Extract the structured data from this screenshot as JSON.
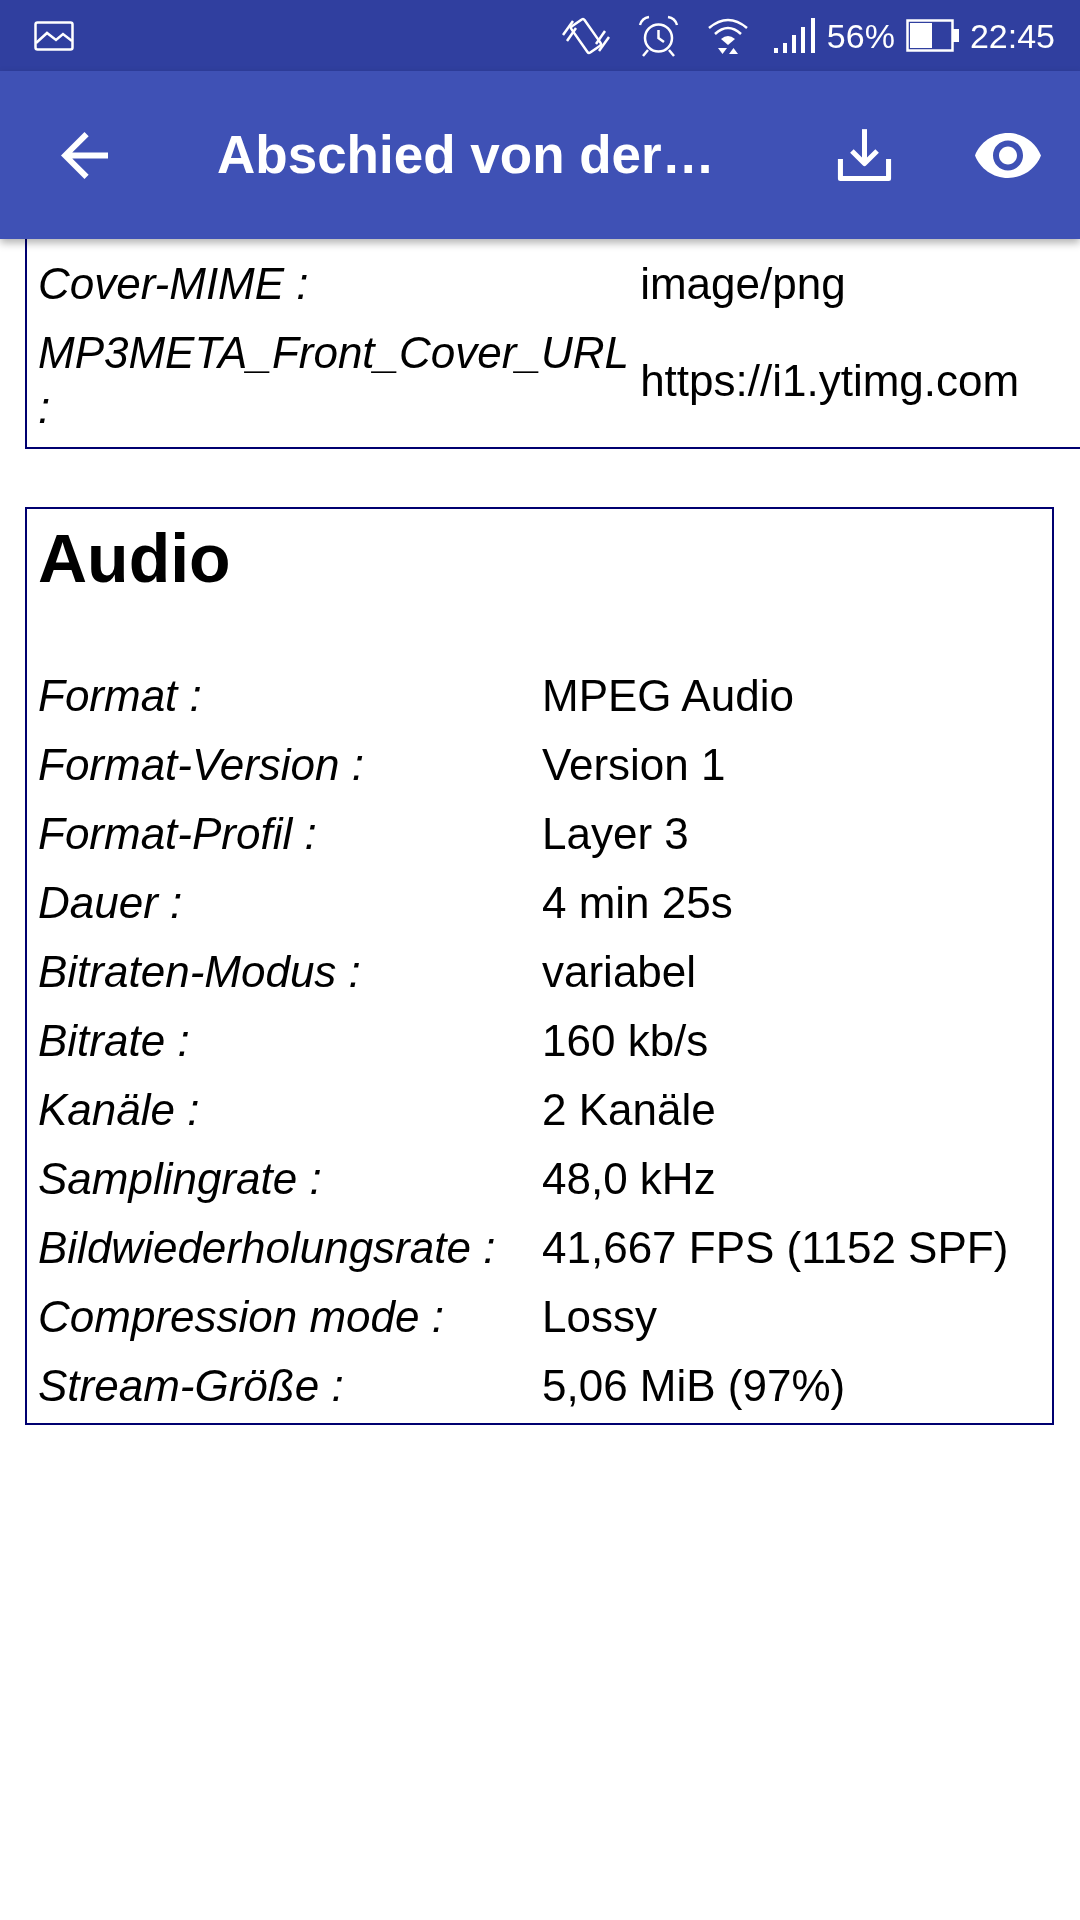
{
  "status_bar": {
    "battery_percent": "56%",
    "time": "22:45"
  },
  "app_bar": {
    "title": "Abschied von der…"
  },
  "sections": [
    {
      "kind": "continued",
      "rows": [
        {
          "label": "Cover-MIME :",
          "value": "image/png"
        },
        {
          "label": "MP3META_Front_Cover_URL :",
          "value": "https://i1.ytimg.com"
        }
      ]
    },
    {
      "kind": "complete",
      "title": "Audio",
      "rows": [
        {
          "label": "Format :",
          "value": "MPEG Audio"
        },
        {
          "label": "Format-Version :",
          "value": "Version 1"
        },
        {
          "label": "Format-Profil :",
          "value": "Layer 3"
        },
        {
          "label": "Dauer :",
          "value": "4 min 25s"
        },
        {
          "label": "Bitraten-Modus :",
          "value": "variabel"
        },
        {
          "label": "Bitrate :",
          "value": "160 kb/s"
        },
        {
          "label": "Kanäle :",
          "value": "2 Kanäle"
        },
        {
          "label": "Samplingrate :",
          "value": "48,0 kHz"
        },
        {
          "label": "Bildwiederholungsrate :",
          "value": "41,667 FPS (1152 SPF)"
        },
        {
          "label": "Compression mode :",
          "value": "Lossy"
        },
        {
          "label": "Stream-Größe :",
          "value": "5,06 MiB (97%)"
        }
      ]
    }
  ]
}
